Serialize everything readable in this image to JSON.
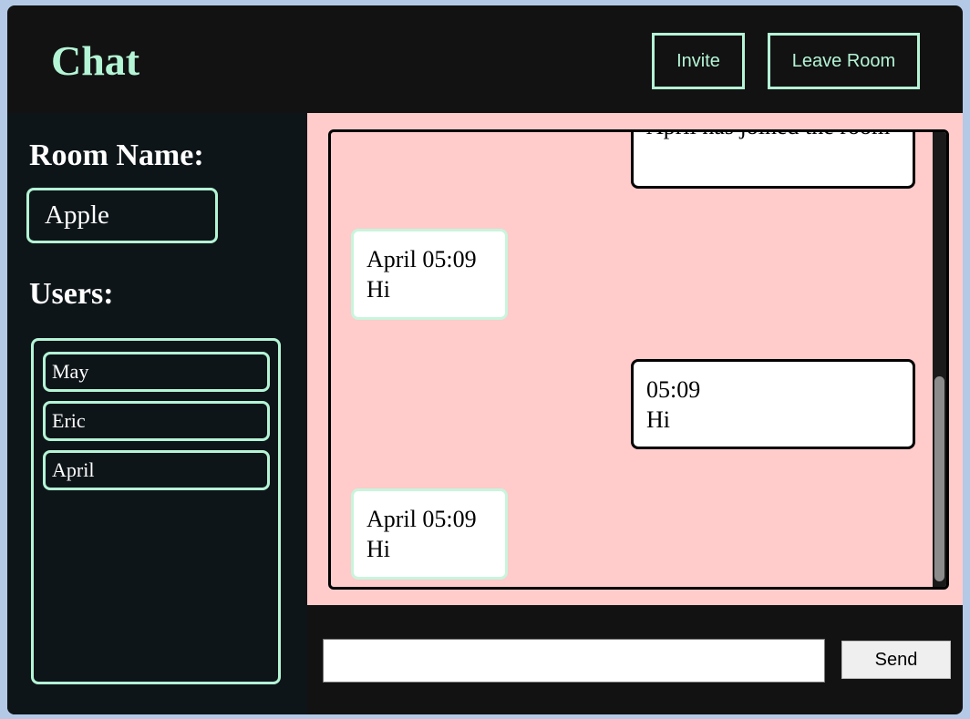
{
  "header": {
    "title": "Chat",
    "invite_label": "Invite",
    "leave_label": "Leave Room"
  },
  "sidebar": {
    "room_label": "Room Name:",
    "room_name": "Apple",
    "users_label": "Users:",
    "users": [
      {
        "name": "May"
      },
      {
        "name": "Eric"
      },
      {
        "name": "April"
      }
    ]
  },
  "messages": [
    {
      "text": "April has joined the room",
      "own": true
    },
    {
      "header": "April 05:09",
      "text": "Hi",
      "own": false
    },
    {
      "header": "05:09",
      "text": "Hi",
      "own": true
    },
    {
      "header": "April 05:09",
      "text": "Hi",
      "own": false
    }
  ],
  "composer": {
    "value": "",
    "send_label": "Send"
  },
  "colors": {
    "accent": "#b4f5d6",
    "chat_bg": "#ffcbcb",
    "panel": "#121212"
  }
}
